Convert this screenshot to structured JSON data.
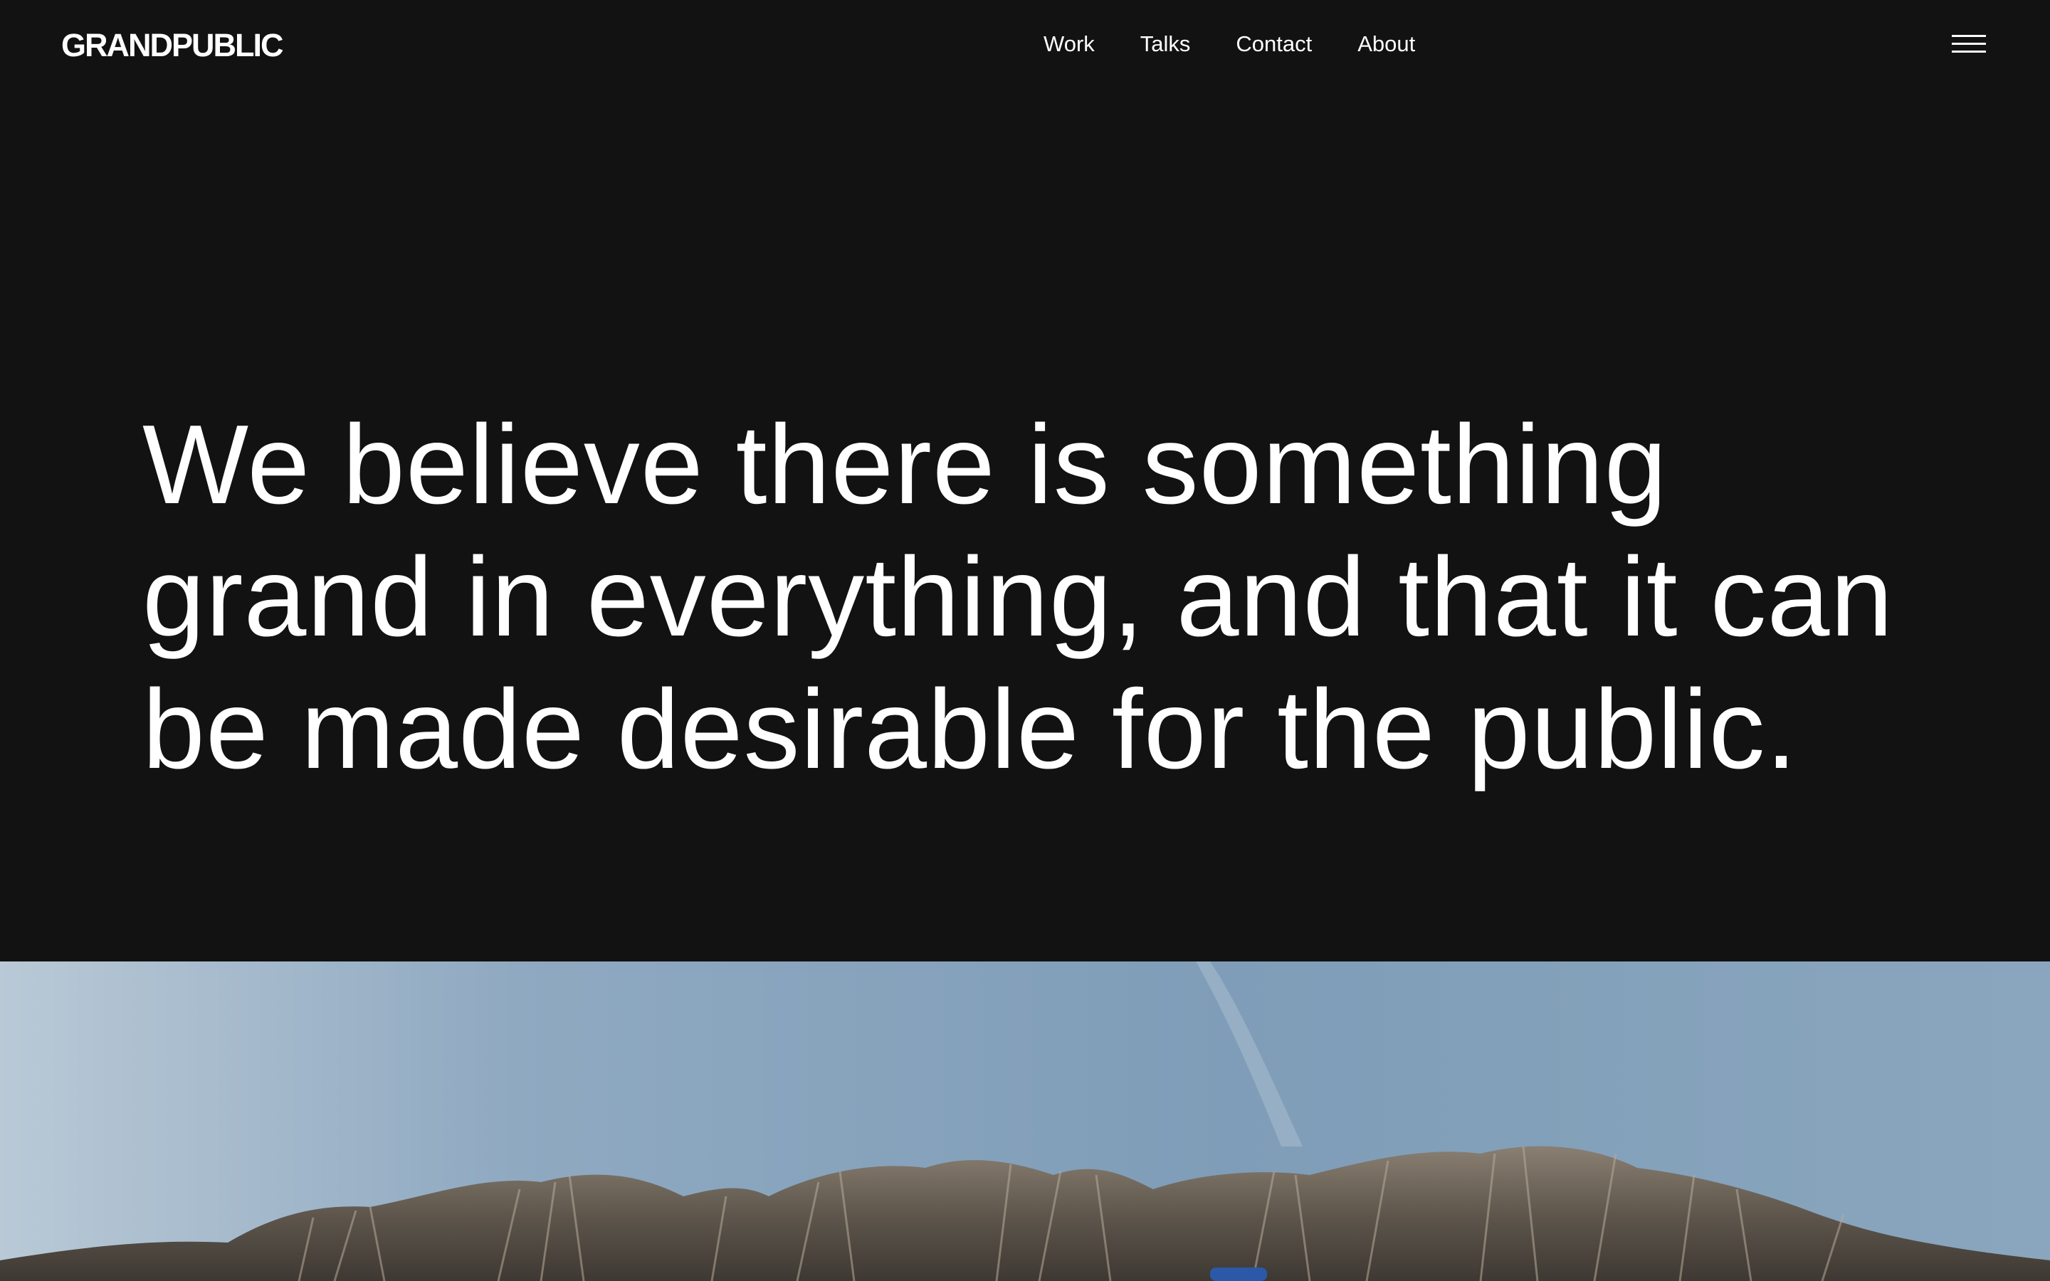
{
  "header": {
    "logo": "GRANDPUBLIC",
    "nav": {
      "work": "Work",
      "talks": "Talks",
      "contact": "Contact",
      "about": "About"
    },
    "menu_icon": "hamburger-menu-icon"
  },
  "hero": {
    "line1": "We believe there is something",
    "line2": "grand in everything, and that it can",
    "line3": "be made desirable for the public."
  },
  "colors": {
    "background": "#121212",
    "text": "#ffffff",
    "sky": "#86a3bc"
  }
}
